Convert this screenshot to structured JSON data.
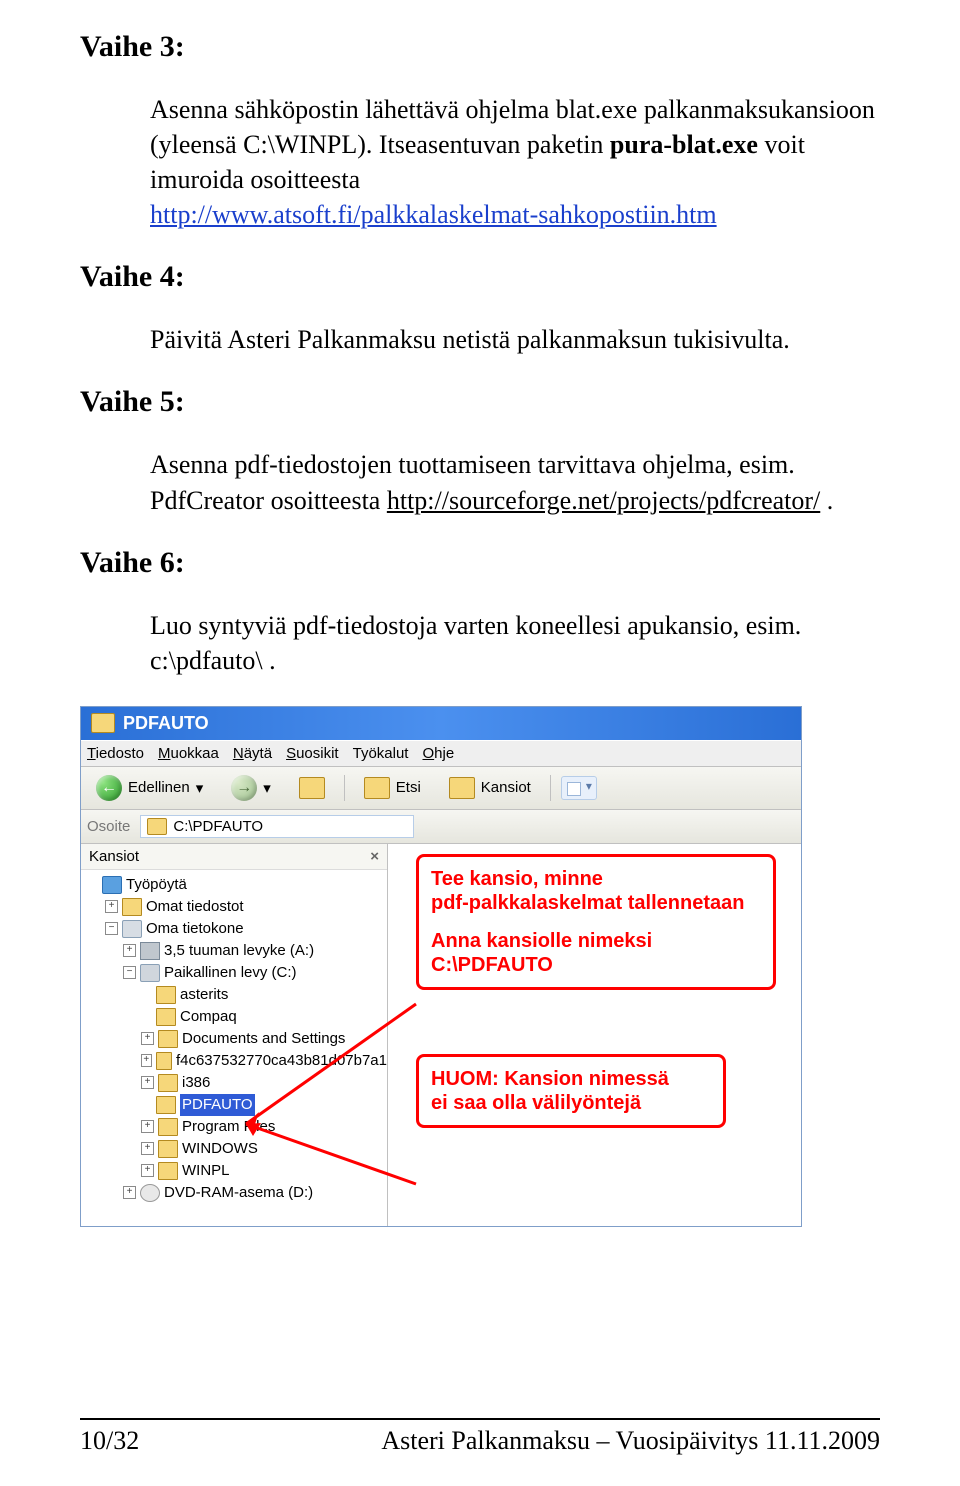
{
  "doc": {
    "vaihe3": "Vaihe 3:",
    "vaihe4": "Vaihe 4:",
    "vaihe5": "Vaihe 5:",
    "vaihe6": "Vaihe 6:",
    "p3_a": "Asenna sähköpostin lähettävä ohjelma blat.exe palkanmaksukansioon (yleensä C:\\WINPL). Itseasentuvan paketin ",
    "p3_bold": "pura-blat.exe",
    "p3_b": " voit imuroida osoitteesta ",
    "p3_link": "http://www.atsoft.fi/palkkalaskelmat-sahkopostiin.htm",
    "p4": "Päivitä Asteri Palkanmaksu netistä palkanmaksun tukisivulta.",
    "p5_a": "Asenna pdf-tiedostojen tuottamiseen tarvittava ohjelma, esim. PdfCreator osoitteesta ",
    "p5_link": "http://sourceforge.net/projects/pdfcreator/",
    "p5_b": " .",
    "p6": "Luo syntyviä pdf-tiedostoja varten koneellesi apukansio, esim. c:\\pdfauto\\ ."
  },
  "shot": {
    "title": "PDFAUTO",
    "menu": [
      "Tiedosto",
      "Muokkaa",
      "Näytä",
      "Suosikit",
      "Työkalut",
      "Ohje"
    ],
    "menu_u": [
      "T",
      "M",
      "N",
      "S",
      "T",
      "O"
    ],
    "toolbar": {
      "back": "Edellinen",
      "search": "Etsi",
      "folders": "Kansiot"
    },
    "address": {
      "label": "Osoite",
      "value": "C:\\PDFAUTO"
    },
    "panel": {
      "title": "Kansiot",
      "close": "×"
    },
    "tree": {
      "desktop": "Työpöytä",
      "mydocs": "Omat tiedostot",
      "mycomp": "Oma tietokone",
      "floppy": "3,5 tuuman levyke (A:)",
      "hdd": "Paikallinen levy (C:)",
      "d1": "asterits",
      "d2": "Compaq",
      "d3": "Documents and Settings",
      "d4": "f4c637532770ca43b81d07b7a1",
      "d5": "i386",
      "d6": "PDFAUTO",
      "d7": "Program Files",
      "d8": "WINDOWS",
      "d9": "WINPL",
      "cd": "DVD-RAM-asema (D:)"
    }
  },
  "annot": {
    "a1_l1": "Tee kansio, minne",
    "a1_l2": "pdf-palkkalaskelmat tallennetaan",
    "a1_l3": "Anna kansiolle nimeksi",
    "a1_l4": "C:\\PDFAUTO",
    "a2_l1": "HUOM: Kansion nimessä",
    "a2_l2": "ei saa olla välilyöntejä"
  },
  "footer": {
    "left": "10/32",
    "right": "Asteri Palkanmaksu – Vuosipäivitys 11.11.2009"
  }
}
